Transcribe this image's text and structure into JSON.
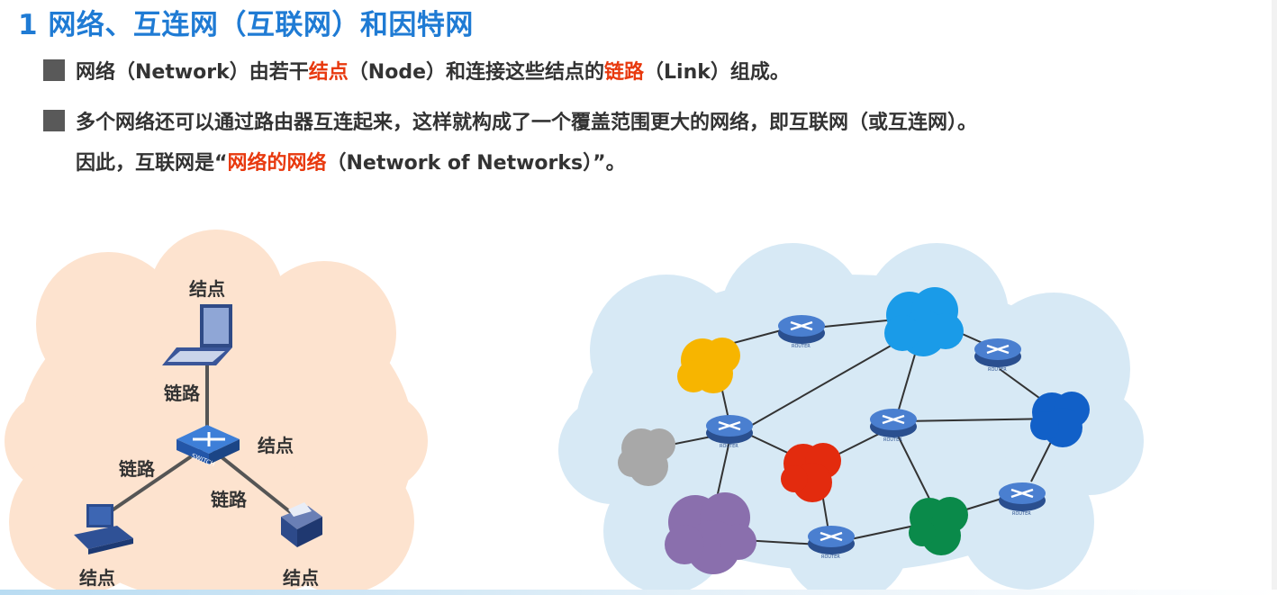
{
  "slide": {
    "title": "1 网络、互连网（互联网）和因特网",
    "bullet1": {
      "p1": "网络（Network）由若干",
      "h1": "结点",
      "p2": "（Node）和连接这些结点的",
      "h2": "链路",
      "p3": "（Link）组成。"
    },
    "bullet2": {
      "line1": "多个网络还可以通过路由器互连起来，这样就构成了一个覆盖范围更大的网络，即互联网（或互连网）。",
      "l2a": "因此，互联网是“",
      "l2h": "网络的网络",
      "l2b": "（Network of Networks）”。"
    }
  },
  "left_diagram": {
    "node_label": "结点",
    "link_label": "链路",
    "switch_text": "SWITCH"
  },
  "right_diagram": {
    "router_text": "ROUTER"
  },
  "colors": {
    "title": "#1f7bd4",
    "highlight": "#e8390e",
    "left_cloud": "#fde3cf",
    "right_cloud": "#d7e9f5"
  }
}
